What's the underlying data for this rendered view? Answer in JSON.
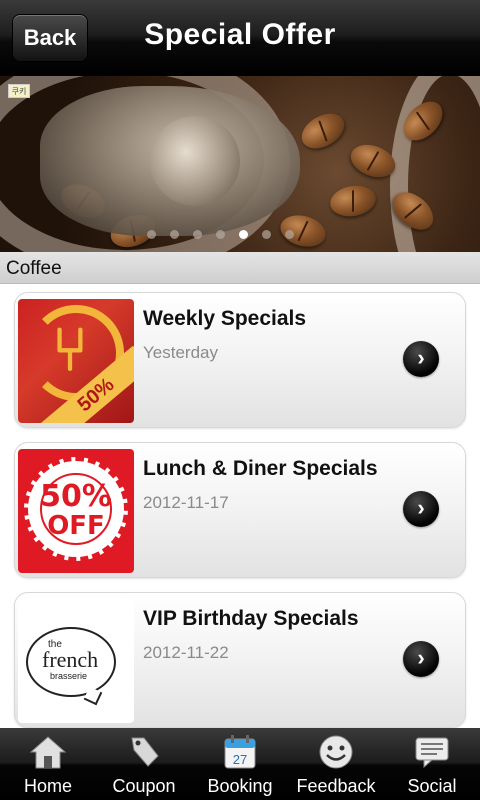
{
  "header": {
    "back_label": "Back",
    "title": "Special Offer"
  },
  "banner": {
    "tag": "쿠키",
    "slide_count": 7,
    "active_slide": 5
  },
  "section": {
    "label": "Coffee"
  },
  "offers": [
    {
      "title": "Weekly Specials",
      "date": "Yesterday",
      "thumbnail_text": "50%"
    },
    {
      "title": "Lunch & Diner Specials",
      "date": "2012-11-17",
      "thumbnail_text_top": "50%",
      "thumbnail_text_bottom": "OFF"
    },
    {
      "title": "VIP Birthday Specials",
      "date": "2012-11-22",
      "thumbnail_text_top": "the",
      "thumbnail_text_main": "french",
      "thumbnail_text_bottom": "brasserie"
    }
  ],
  "tabs": [
    {
      "label": "Home",
      "icon": "home-icon"
    },
    {
      "label": "Coupon",
      "icon": "coupon-tag-icon"
    },
    {
      "label": "Booking",
      "icon": "calendar-icon",
      "icon_text": "27"
    },
    {
      "label": "Feedback",
      "icon": "smiley-icon"
    },
    {
      "label": "Social",
      "icon": "chat-bubble-icon"
    }
  ],
  "colors": {
    "header_bg": "#000000",
    "sale_red": "#e01a24",
    "gold": "#f2b63a",
    "booking_blue": "#3aa0e0"
  }
}
